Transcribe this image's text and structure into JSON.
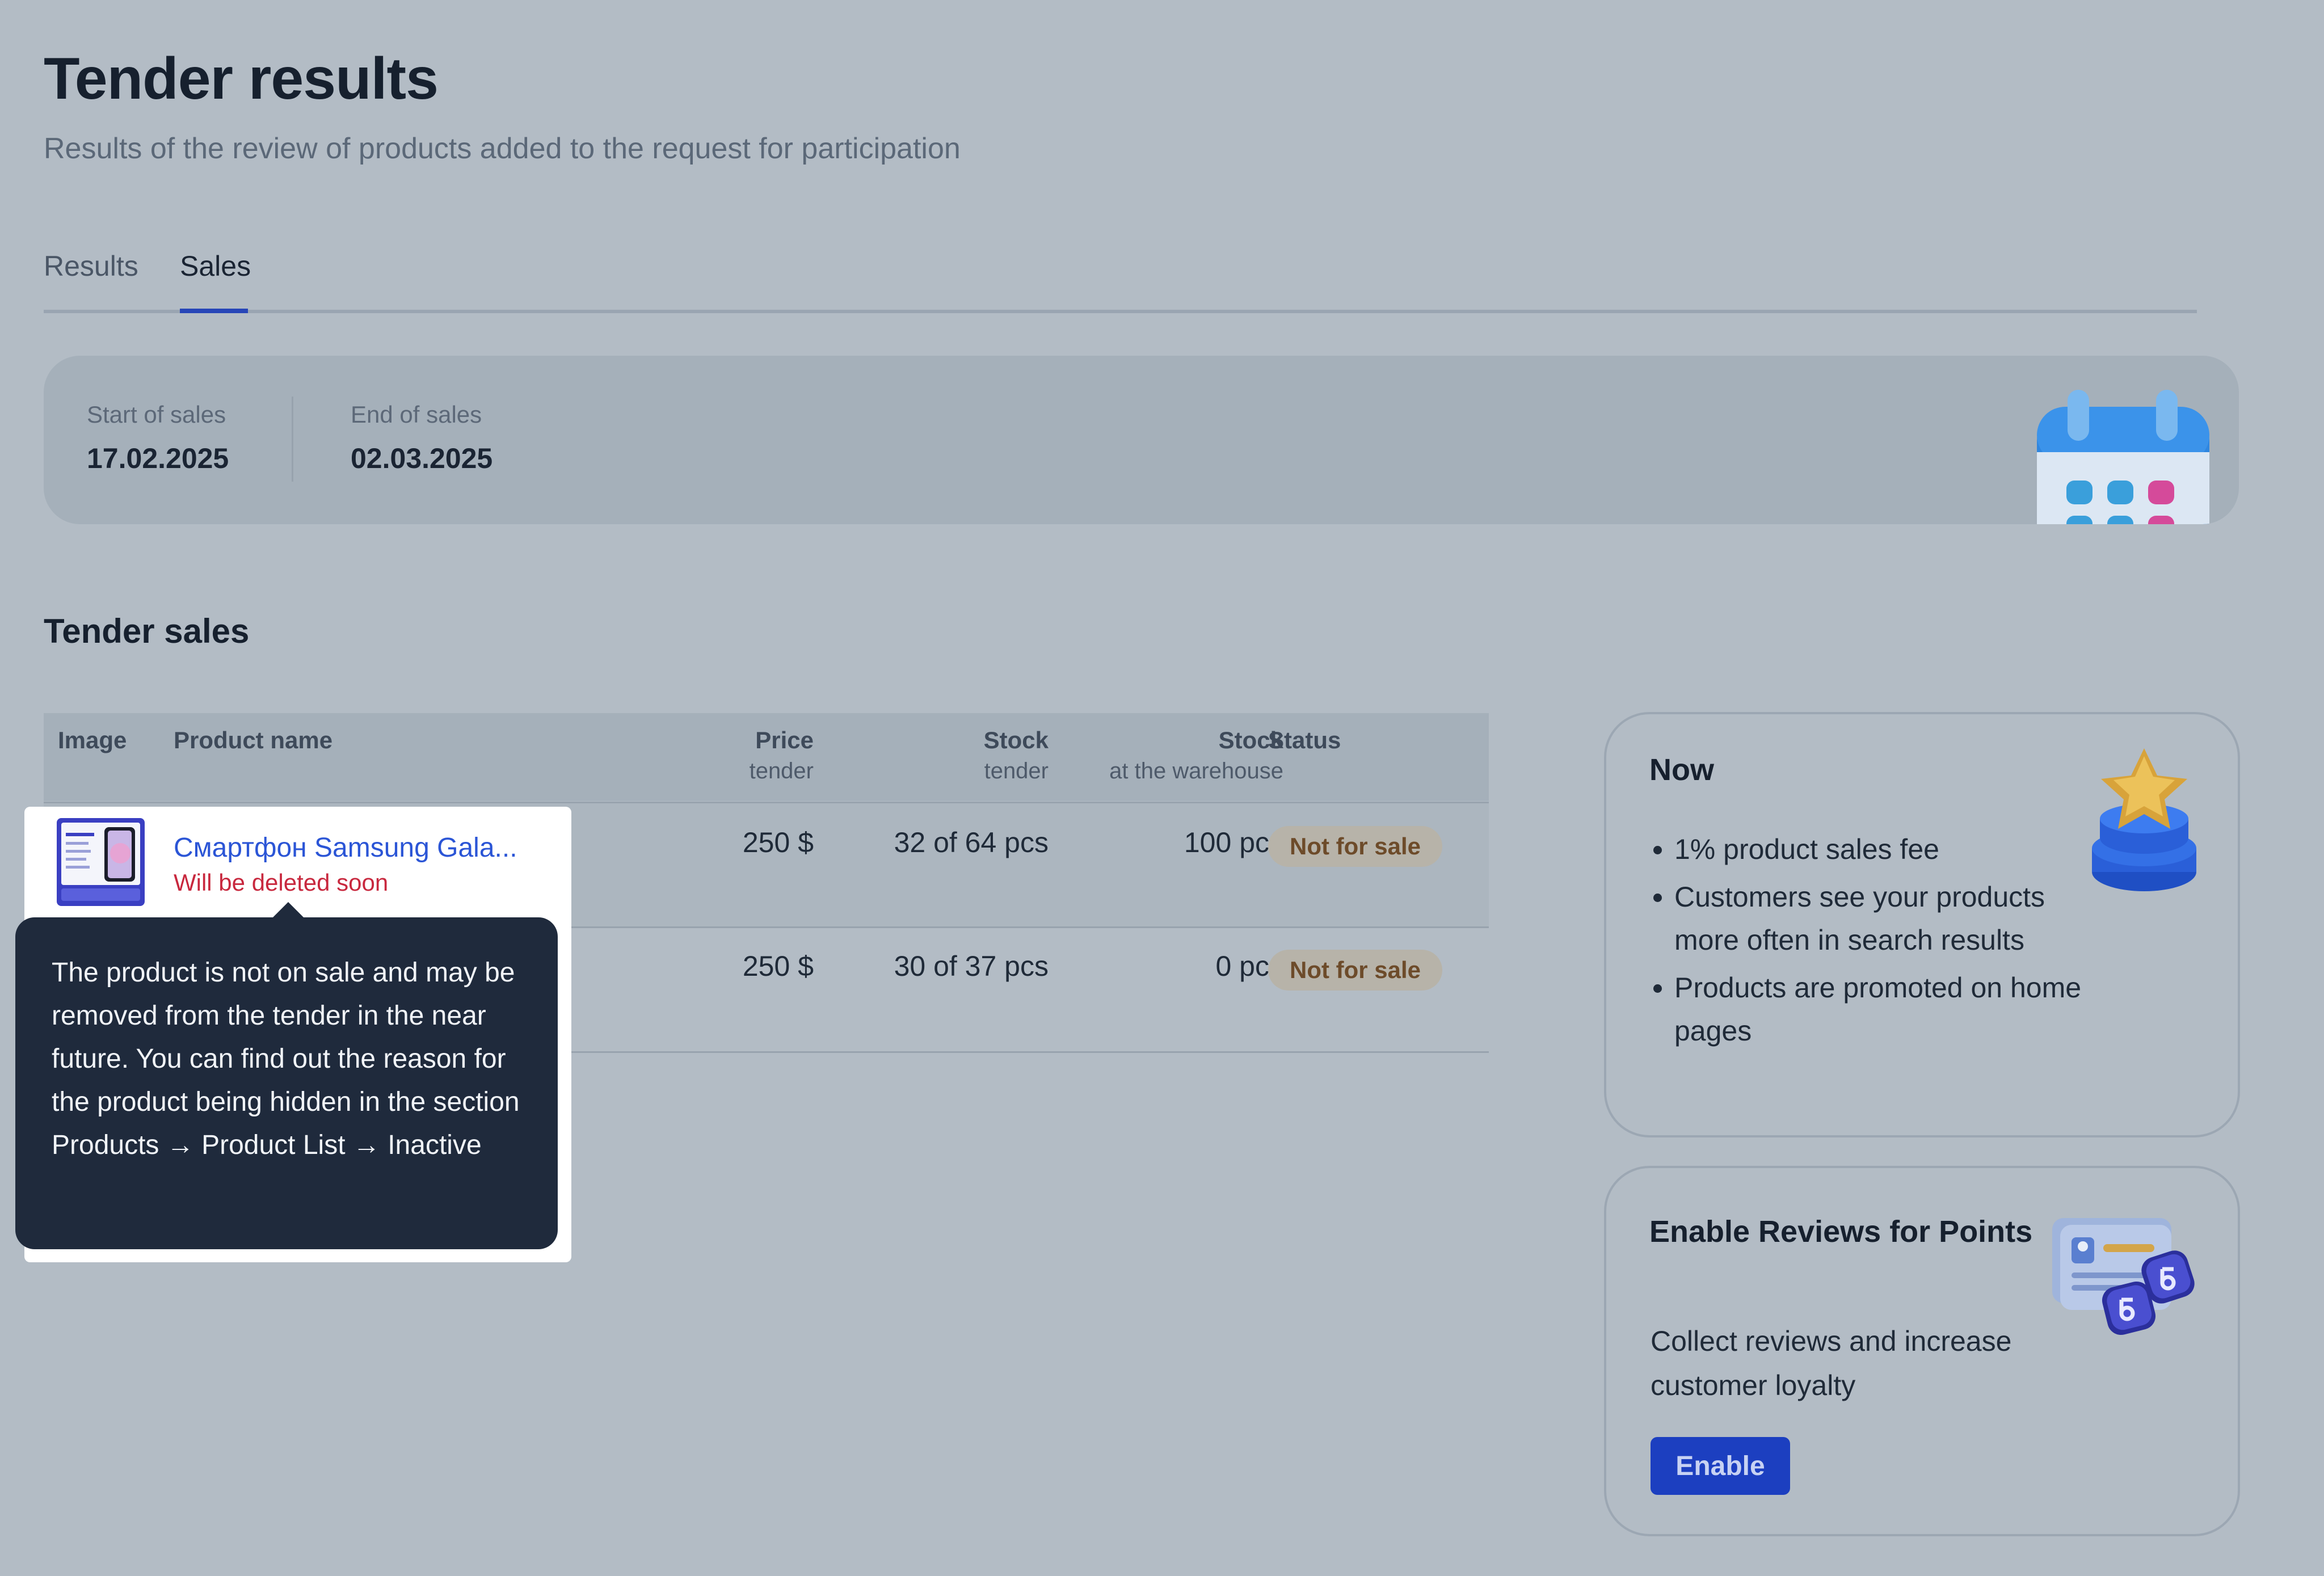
{
  "header": {
    "title": "Tender results",
    "subtitle": "Results of the review of products added to the request for participation"
  },
  "tabs": [
    {
      "label": "Results",
      "active": false
    },
    {
      "label": "Sales",
      "active": true
    }
  ],
  "sales_period": {
    "start_label": "Start of sales",
    "start_value": "17.02.2025",
    "end_label": "End of sales",
    "end_value": "02.03.2025",
    "illustration": "calendar-icon"
  },
  "tender_sales": {
    "title": "Tender sales",
    "columns": {
      "image": "Image",
      "product_name": "Product name",
      "price": "Price",
      "price_sub": "tender",
      "stock_tender": "Stock",
      "stock_tender_sub": "tender",
      "stock_warehouse": "Stock",
      "stock_warehouse_sub": "at the warehouse",
      "status": "Status"
    },
    "rows": [
      {
        "name": "Смартфон Samsung Gala...",
        "note": "Will be deleted soon",
        "price": "250 $",
        "stock_tender": "32 of 64 pcs",
        "stock_warehouse": "100 pcs",
        "status": "Not for sale"
      },
      {
        "price": "250 $",
        "stock_tender": "30 of 37 pcs",
        "stock_warehouse": "0 pcs",
        "status": "Not for sale"
      }
    ]
  },
  "tooltip": {
    "text": "The product is not on sale and may be removed from the tender in the near future. You can find out the reason for the product being hidden in the section Products → Product List → Inactive"
  },
  "cards": {
    "now": {
      "title": "Now",
      "items": [
        "1% product sales fee",
        "Customers see your products more often in search results",
        "Products are promoted on home pages"
      ],
      "illustration": "star-trophy-icon"
    },
    "reviews": {
      "title": "Enable Reviews for Points",
      "text": "Collect reviews and increase customer loyalty",
      "button": "Enable",
      "illustration": "review-points-icon"
    }
  },
  "colors": {
    "accent": "#2746b8",
    "link": "#2b55d6",
    "danger": "#c8283e",
    "status_badge_bg": "#b7b3a9",
    "status_badge_text": "#6d4b2a",
    "tooltip_bg": "#1f2a3c",
    "button_bg": "#1c3fc0"
  }
}
